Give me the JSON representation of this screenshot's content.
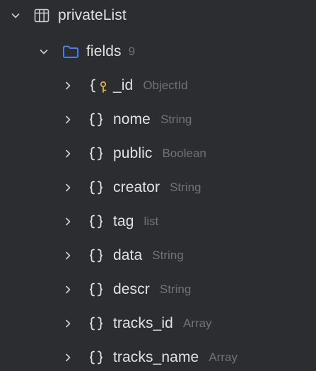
{
  "tree": {
    "table": {
      "name": "privateList",
      "icon": "table-icon",
      "expanded": true
    },
    "folder": {
      "name": "fields",
      "count": "9",
      "icon": "folder-icon",
      "expanded": true
    },
    "fields": [
      {
        "name": "_id",
        "type": "ObjectId",
        "icon": "primary-key-field-icon"
      },
      {
        "name": "nome",
        "type": "String",
        "icon": "field-braces-icon"
      },
      {
        "name": "public",
        "type": "Boolean",
        "icon": "field-braces-icon"
      },
      {
        "name": "creator",
        "type": "String",
        "icon": "field-braces-icon"
      },
      {
        "name": "tag",
        "type": "list",
        "icon": "field-braces-icon"
      },
      {
        "name": "data",
        "type": "String",
        "icon": "field-braces-icon"
      },
      {
        "name": "descr",
        "type": "String",
        "icon": "field-braces-icon"
      },
      {
        "name": "tracks_id",
        "type": "Array",
        "icon": "field-braces-icon"
      },
      {
        "name": "tracks_name",
        "type": "Array",
        "icon": "field-braces-icon"
      }
    ]
  },
  "colors": {
    "background": "#2b2d30",
    "text": "#dfe1e5",
    "muted_text": "#6f737a",
    "folder_icon": "#548af7",
    "key_icon": "#e3b341"
  }
}
